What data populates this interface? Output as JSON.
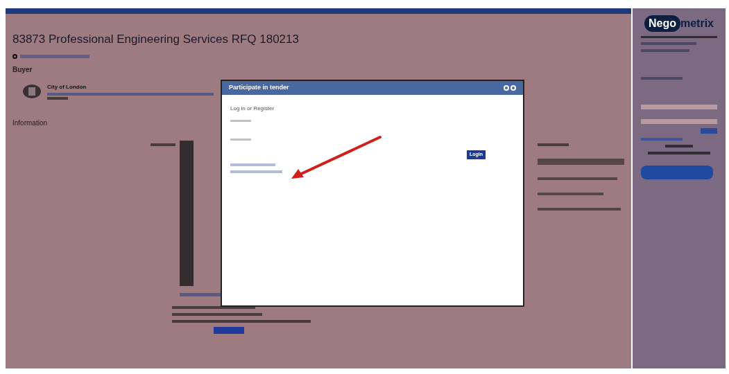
{
  "page": {
    "title": "83873 Professional Engineering Services RFQ 180213",
    "buyer_heading": "Buyer",
    "buyer_name": "City of London",
    "info_heading": "Information"
  },
  "dialog": {
    "title": "Participate in tender",
    "heading": "Log in or Register",
    "button": "Login"
  },
  "logo": {
    "lead": "Nego",
    "rest": "metrix"
  }
}
